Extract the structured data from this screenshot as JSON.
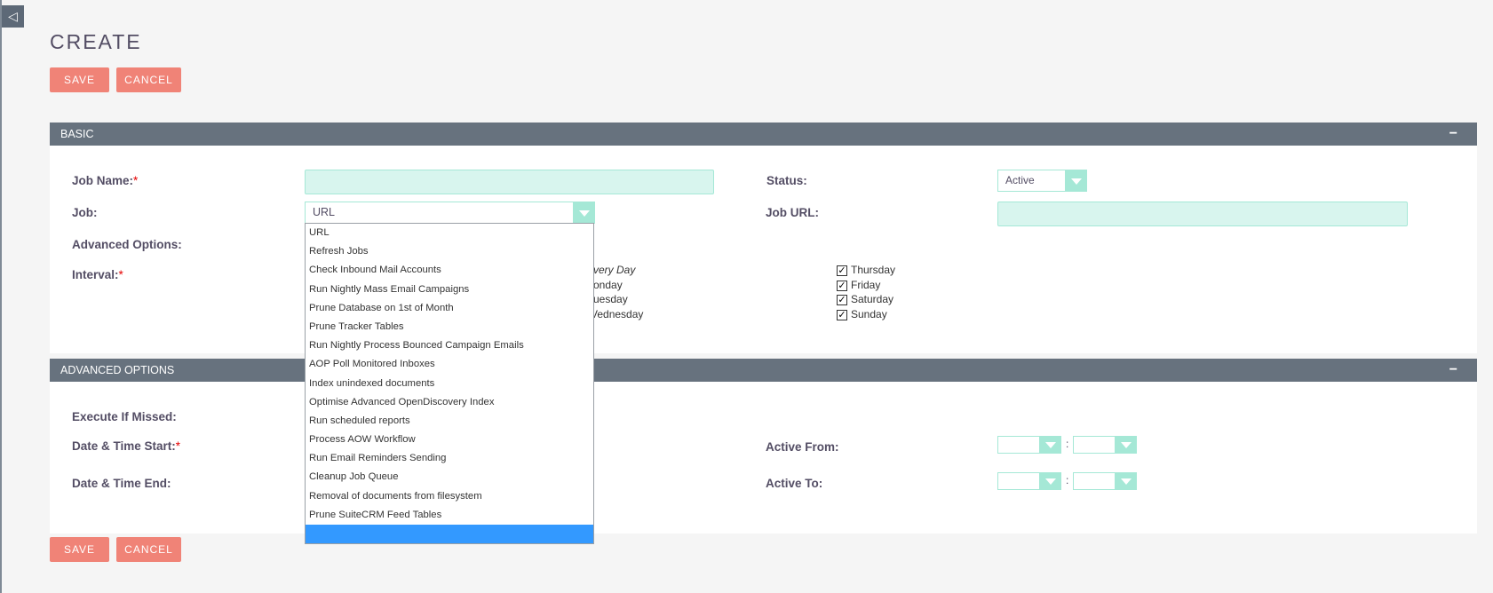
{
  "page": {
    "title": "CREATE",
    "collapse_glyph": "◁"
  },
  "buttons": {
    "save": "SAVE",
    "cancel": "CANCEL"
  },
  "basic": {
    "header": "BASIC",
    "collapse": "−",
    "job_name_label": "Job Name:",
    "required_mark": "*",
    "job_label": "Job:",
    "job_value": "URL",
    "advanced_options_label": "Advanced Options:",
    "interval_label": "Interval:",
    "status_label": "Status:",
    "status_value": "Active",
    "job_url_label": "Job URL:",
    "days_partial": {
      "every_day": "very Day",
      "monday": "onday",
      "tuesday": "uesday",
      "wednesday": "Vednesday"
    },
    "days": [
      {
        "label": "Thursday",
        "checked": true
      },
      {
        "label": "Friday",
        "checked": true
      },
      {
        "label": "Saturday",
        "checked": true
      },
      {
        "label": "Sunday",
        "checked": true
      }
    ],
    "check_glyph": "✓"
  },
  "advanced": {
    "header": "ADVANCED OPTIONS",
    "collapse": "−",
    "execute_if_missed_label": "Execute If Missed:",
    "date_time_start_label": "Date & Time Start:",
    "date_time_end_label": "Date & Time End:",
    "active_from_label": "Active From:",
    "active_to_label": "Active To:",
    "time_separator": ":"
  },
  "job_dropdown": {
    "options": [
      "URL",
      "Refresh Jobs",
      "Check Inbound Mail Accounts",
      "Run Nightly Mass Email Campaigns",
      "Prune Database on 1st of Month",
      "Prune Tracker Tables",
      "Run Nightly Process Bounced Campaign Emails",
      "AOP Poll Monitored Inboxes",
      "Index unindexed documents",
      "Optimise Advanced OpenDiscovery Index",
      "Run scheduled reports",
      "Process AOW Workflow",
      "Run Email Reminders Sending",
      "Cleanup Job Queue",
      "Removal of documents from filesystem",
      "Prune SuiteCRM Feed Tables",
      ""
    ],
    "highlighted_index": 16
  },
  "colors": {
    "button": "#f08377",
    "panel_header": "#67727e",
    "input_fill": "#d8f5ee",
    "input_border": "#a5e8d6",
    "highlight": "#3399ff"
  }
}
